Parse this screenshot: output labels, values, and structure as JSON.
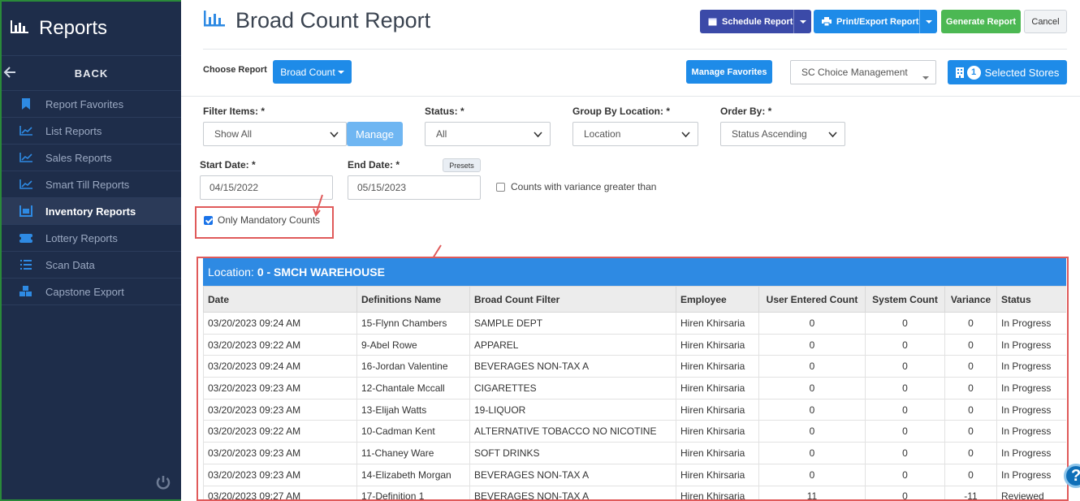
{
  "sidebar": {
    "title": "Reports",
    "back_label": "BACK",
    "items": [
      {
        "label": "Report Favorites",
        "icon": "bookmark-icon"
      },
      {
        "label": "List Reports",
        "icon": "line-chart-icon"
      },
      {
        "label": "Sales Reports",
        "icon": "line-chart-icon"
      },
      {
        "label": "Smart Till Reports",
        "icon": "line-chart-icon"
      },
      {
        "label": "Inventory Reports",
        "icon": "inventory-icon"
      },
      {
        "label": "Lottery Reports",
        "icon": "ticket-icon"
      },
      {
        "label": "Scan Data",
        "icon": "list-icon"
      },
      {
        "label": "Capstone Export",
        "icon": "cubes-icon"
      }
    ],
    "active_index": 4
  },
  "header": {
    "title": "Broad Count Report",
    "schedule_label": "Schedule Report",
    "print_label": "Print/Export Report",
    "generate_label": "Generate Report",
    "cancel_label": "Cancel"
  },
  "choose": {
    "label": "Choose Report",
    "value": "Broad Count",
    "manage_favorites": "Manage Favorites",
    "store_group": "SC Choice Management",
    "selected_count": "1",
    "selected_label": "Selected Stores"
  },
  "filters": {
    "filter_items_label": "Filter Items: *",
    "filter_items_value": "Show All",
    "manage_label": "Manage",
    "status_label": "Status: *",
    "status_value": "All",
    "group_label": "Group By Location: *",
    "group_value": "Location",
    "order_label": "Order By: *",
    "order_value": "Status Ascending",
    "start_label": "Start Date: *",
    "start_value": "04/15/2022",
    "end_label": "End Date: *",
    "end_value": "05/15/2023",
    "presets_label": "Presets",
    "variance_label": "Counts with variance greater than",
    "mandatory_label": "Only Mandatory Counts"
  },
  "table": {
    "location_prefix": "Location:",
    "location_name": "0 - SMCH WAREHOUSE",
    "columns": [
      "Date",
      "Definitions Name",
      "Broad Count Filter",
      "Employee",
      "User Entered Count",
      "System Count",
      "Variance",
      "Status"
    ],
    "rows": [
      [
        "03/20/2023 09:24 AM",
        "15-Flynn Chambers",
        "SAMPLE DEPT",
        "Hiren Khirsaria",
        "0",
        "0",
        "0",
        "In Progress"
      ],
      [
        "03/20/2023 09:22 AM",
        "9-Abel Rowe",
        "APPAREL",
        "Hiren Khirsaria",
        "0",
        "0",
        "0",
        "In Progress"
      ],
      [
        "03/20/2023 09:24 AM",
        "16-Jordan Valentine",
        "BEVERAGES NON-TAX A",
        "Hiren Khirsaria",
        "0",
        "0",
        "0",
        "In Progress"
      ],
      [
        "03/20/2023 09:23 AM",
        "12-Chantale Mccall",
        "CIGARETTES",
        "Hiren Khirsaria",
        "0",
        "0",
        "0",
        "In Progress"
      ],
      [
        "03/20/2023 09:23 AM",
        "13-Elijah Watts",
        "19-LIQUOR",
        "Hiren Khirsaria",
        "0",
        "0",
        "0",
        "In Progress"
      ],
      [
        "03/20/2023 09:22 AM",
        "10-Cadman Kent",
        "ALTERNATIVE TOBACCO NO NICOTINE",
        "Hiren Khirsaria",
        "0",
        "0",
        "0",
        "In Progress"
      ],
      [
        "03/20/2023 09:23 AM",
        "11-Chaney Ware",
        "SOFT DRINKS",
        "Hiren Khirsaria",
        "0",
        "0",
        "0",
        "In Progress"
      ],
      [
        "03/20/2023 09:23 AM",
        "14-Elizabeth Morgan",
        "BEVERAGES NON-TAX A",
        "Hiren Khirsaria",
        "0",
        "0",
        "0",
        "In Progress"
      ],
      [
        "03/20/2023 09:27 AM",
        "17-Definition 1",
        "BEVERAGES NON-TAX A",
        "Hiren Khirsaria",
        "11",
        "0",
        "-11",
        "Reviewed"
      ]
    ]
  },
  "colors": {
    "sidebar_bg": "#1e2d4a",
    "primary_blue": "#1e8be8",
    "navy": "#3b4aa8",
    "green": "#4cb853",
    "annotation_red": "#e05a5a"
  }
}
